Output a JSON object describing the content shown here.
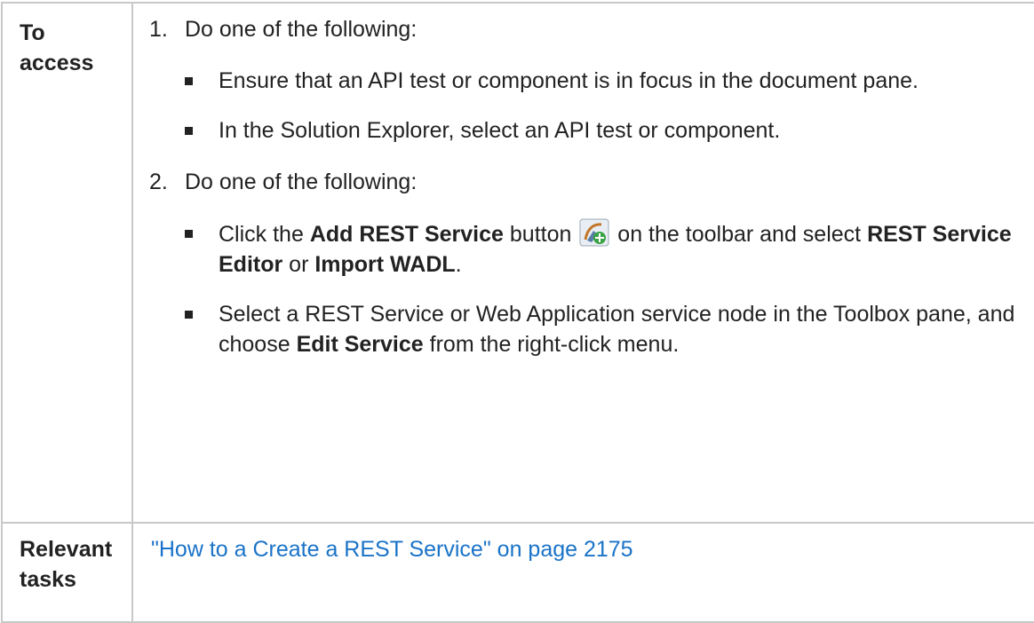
{
  "access": {
    "label_line1": "To",
    "label_line2": "access",
    "step1_num": "1.",
    "step1_text": "Do one of the following:",
    "step1_bullets": [
      "Ensure that an API test or component is in focus in the document pane.",
      "In the Solution Explorer, select an API test or component."
    ],
    "step2_num": "2.",
    "step2_text": "Do one of the following:",
    "bullet3": {
      "pre": "Click the ",
      "bold1": "Add REST Service",
      "mid1": " button ",
      "mid2": " on the toolbar and select ",
      "bold2": "REST Service Editor",
      "mid3": " or ",
      "bold3": "Import WADL",
      "post": "."
    },
    "bullet4": {
      "pre": "Select a REST Service or Web Application service node in the Toolbox pane, and choose ",
      "bold": "Edit Service",
      "post": " from the right-click menu."
    }
  },
  "tasks": {
    "label_line1": "Relevant",
    "label_line2": "tasks",
    "link_text": "\"How to a Create a REST Service\" on page 2175"
  },
  "icons": {
    "add_rest_service": "add-rest-service-icon"
  }
}
